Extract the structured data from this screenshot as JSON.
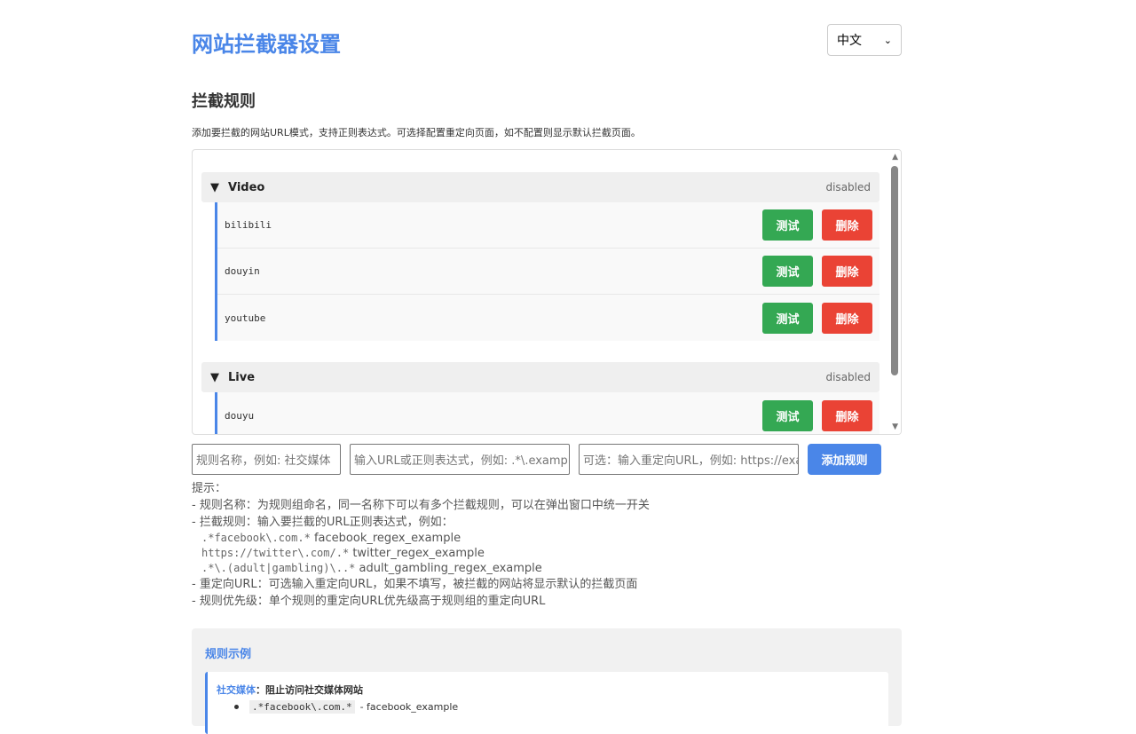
{
  "header": {
    "title": "网站拦截器设置",
    "language": "中文"
  },
  "rules_section": {
    "title": "拦截规则",
    "description": "添加要拦截的网站URL模式，支持正则表达式。可选择配置重定向页面，如不配置则显示默认拦截页面。",
    "test_label": "测试",
    "delete_label": "删除",
    "groups": [
      {
        "name": "Video",
        "status": "disabled",
        "rules": [
          "bilibili",
          "douyin",
          "youtube"
        ]
      },
      {
        "name": "Live",
        "status": "disabled",
        "rules": [
          "douyu"
        ]
      }
    ]
  },
  "add_form": {
    "name_placeholder": "规则名称，例如: 社交媒体",
    "pattern_placeholder": "输入URL或正则表达式，例如: .*\\.example\\.com.*",
    "redirect_placeholder": "可选：输入重定向URL，例如: https://example.com",
    "add_label": "添加规则"
  },
  "tips": {
    "heading": "提示：",
    "line1": "- 规则名称：为规则组命名，同一名称下可以有多个拦截规则，可以在弹出窗口中统一开关",
    "line2": "- 拦截规则：输入要拦截的URL正则表达式，例如：",
    "examples": [
      {
        "pattern": ".*facebook\\.com.*",
        "name": "facebook_regex_example"
      },
      {
        "pattern": "https://twitter\\.com/.*",
        "name": "twitter_regex_example"
      },
      {
        "pattern": ".*\\.(adult|gambling)\\..*",
        "name": "adult_gambling_regex_example"
      }
    ],
    "line3": "- 重定向URL：可选输入重定向URL，如果不填写，被拦截的网站将显示默认的拦截页面",
    "line4": "- 规则优先级：单个规则的重定向URL优先级高于规则组的重定向URL"
  },
  "examples_section": {
    "title": "规则示例",
    "card_name": "社交媒体",
    "card_desc": "：阻止访问社交媒体网站",
    "item_pattern": ".*facebook\\.com.*",
    "item_desc": "- facebook_example"
  }
}
